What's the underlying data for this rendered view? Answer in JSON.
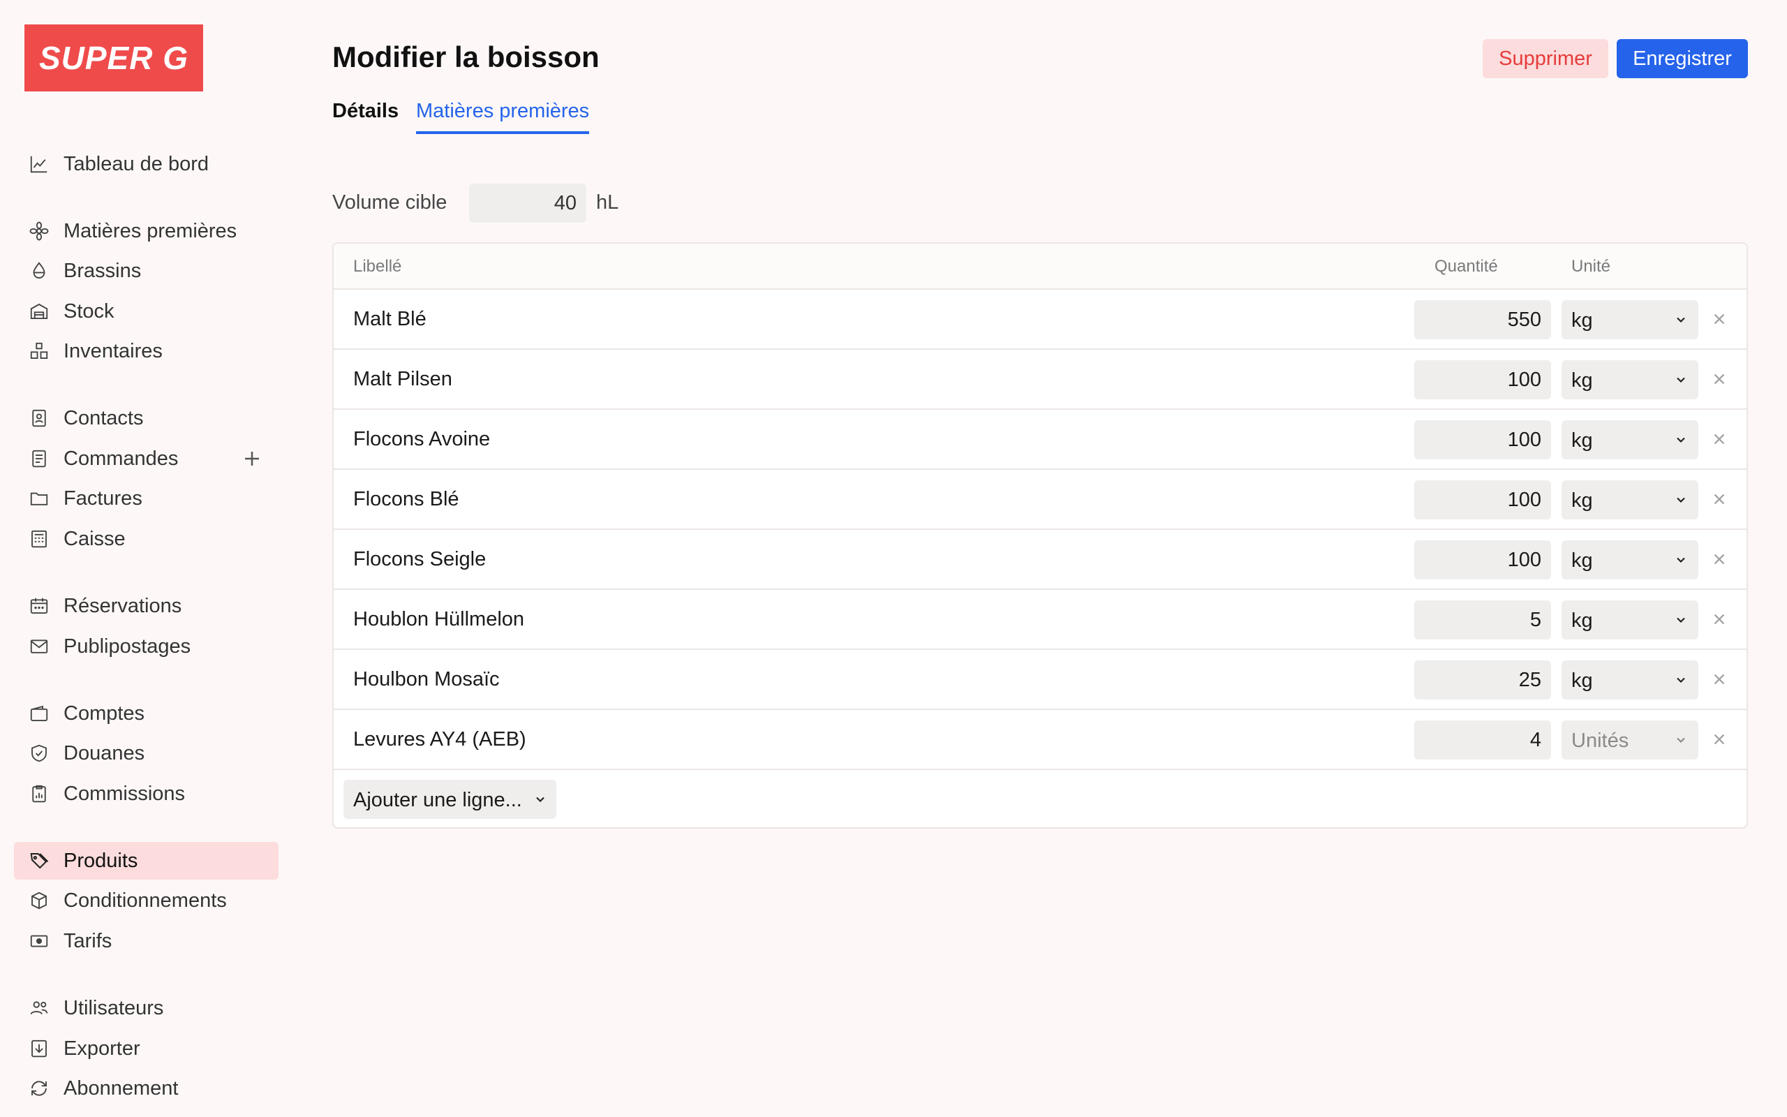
{
  "brand": {
    "name": "SUPER G",
    "color": "#ef4b4b"
  },
  "sidebar": {
    "items": [
      {
        "label": "Tableau de bord",
        "icon": "chart-line-icon"
      },
      {
        "label": "Matières premières",
        "icon": "grain-icon"
      },
      {
        "label": "Brassins",
        "icon": "droplet-icon"
      },
      {
        "label": "Stock",
        "icon": "warehouse-icon"
      },
      {
        "label": "Inventaires",
        "icon": "boxes-icon"
      },
      {
        "label": "Contacts",
        "icon": "contact-book-icon"
      },
      {
        "label": "Commandes",
        "icon": "order-list-icon"
      },
      {
        "label": "Factures",
        "icon": "folder-icon"
      },
      {
        "label": "Caisse",
        "icon": "cash-register-icon"
      },
      {
        "label": "Réservations",
        "icon": "calendar-icon"
      },
      {
        "label": "Publipostages",
        "icon": "envelope-icon"
      },
      {
        "label": "Comptes",
        "icon": "wallet-icon"
      },
      {
        "label": "Douanes",
        "icon": "shield-check-icon"
      },
      {
        "label": "Commissions",
        "icon": "clipboard-chart-icon"
      },
      {
        "label": "Produits",
        "icon": "tags-icon",
        "active": true
      },
      {
        "label": "Conditionnements",
        "icon": "package-icon"
      },
      {
        "label": "Tarifs",
        "icon": "banknote-icon"
      },
      {
        "label": "Utilisateurs",
        "icon": "users-icon"
      },
      {
        "label": "Exporter",
        "icon": "download-icon"
      },
      {
        "label": "Abonnement",
        "icon": "refresh-icon"
      }
    ],
    "add_icon": "plus-icon"
  },
  "header": {
    "title": "Modifier la boisson",
    "delete_label": "Supprimer",
    "save_label": "Enregistrer"
  },
  "tabs": [
    {
      "label": "Détails",
      "active": false
    },
    {
      "label": "Matières premières",
      "active": true
    }
  ],
  "volume": {
    "label": "Volume cible",
    "value": "40",
    "unit": "hL"
  },
  "table": {
    "columns": {
      "label": "Libellé",
      "quantity": "Quantité",
      "unit": "Unité"
    },
    "rows": [
      {
        "name": "Malt Blé",
        "quantity": "550",
        "unit": "kg"
      },
      {
        "name": "Malt Pilsen",
        "quantity": "100",
        "unit": "kg"
      },
      {
        "name": "Flocons Avoine",
        "quantity": "100",
        "unit": "kg"
      },
      {
        "name": "Flocons Blé",
        "quantity": "100",
        "unit": "kg"
      },
      {
        "name": "Flocons Seigle",
        "quantity": "100",
        "unit": "kg"
      },
      {
        "name": "Houblon Hüllmelon",
        "quantity": "5",
        "unit": "kg"
      },
      {
        "name": "Houlbon Mosaïc",
        "quantity": "25",
        "unit": "kg"
      },
      {
        "name": "Levures AY4 (AEB)",
        "quantity": "4",
        "unit": "Unités"
      }
    ],
    "add_line_label": "Ajouter une ligne..."
  },
  "colors": {
    "accent": "#2563eb",
    "danger": "#e53c3c",
    "danger_bg": "#fcdcdc",
    "active_nav_bg": "#fcdcdc"
  }
}
